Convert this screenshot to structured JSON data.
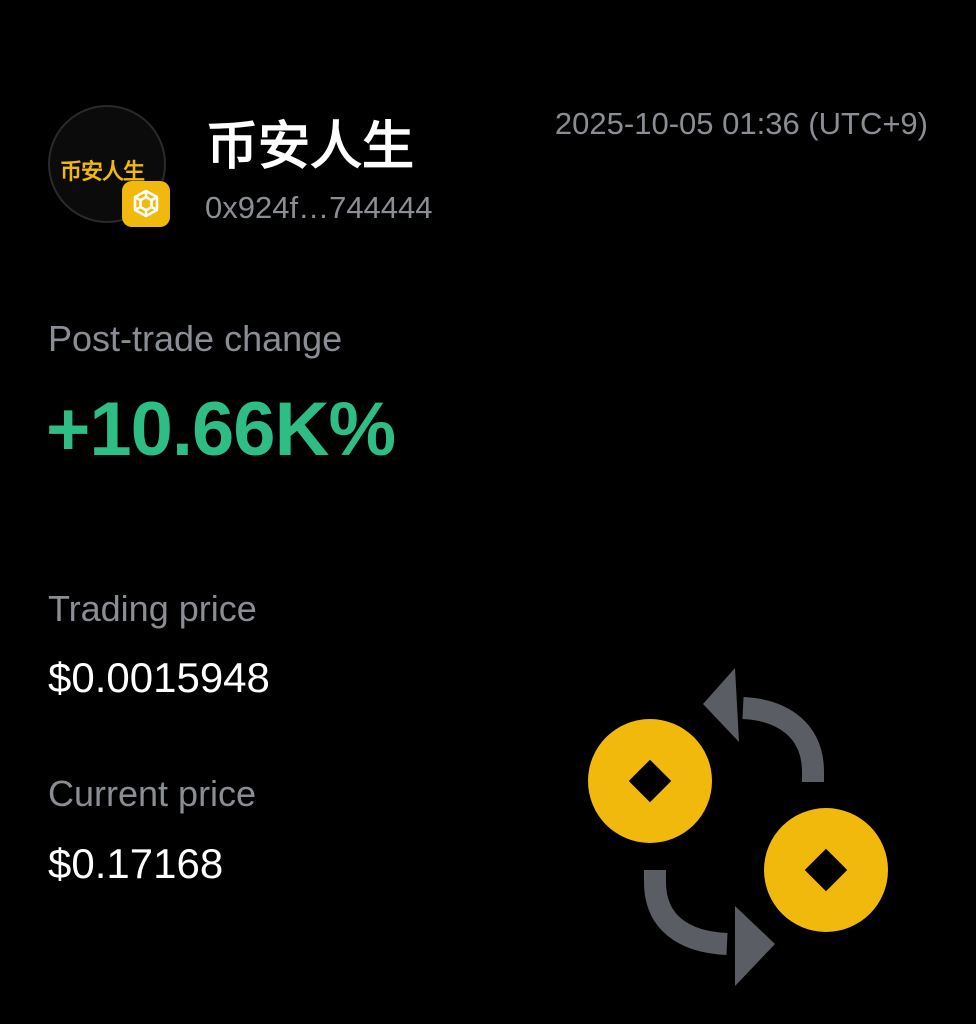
{
  "profile": {
    "avatar_text": "币安人生",
    "badge_icon": "bnb-logo-icon",
    "name": "币安人生",
    "address": "0x924f…744444"
  },
  "timestamp": "2025-10-05 01:36 (UTC+9)",
  "stats": {
    "change_label": "Post-trade change",
    "change_value": "+10.66K%",
    "trading_label": "Trading price",
    "trading_value": "$0.0015948",
    "current_label": "Current price",
    "current_value": "$0.17168"
  },
  "illustration": {
    "icon": "coin-exchange-icon"
  },
  "colors": {
    "background": "#000000",
    "positive": "#2ebd85",
    "muted_text": "#8a8d93",
    "accent": "#f0b90b",
    "arrow_gray": "#5a5d63"
  }
}
